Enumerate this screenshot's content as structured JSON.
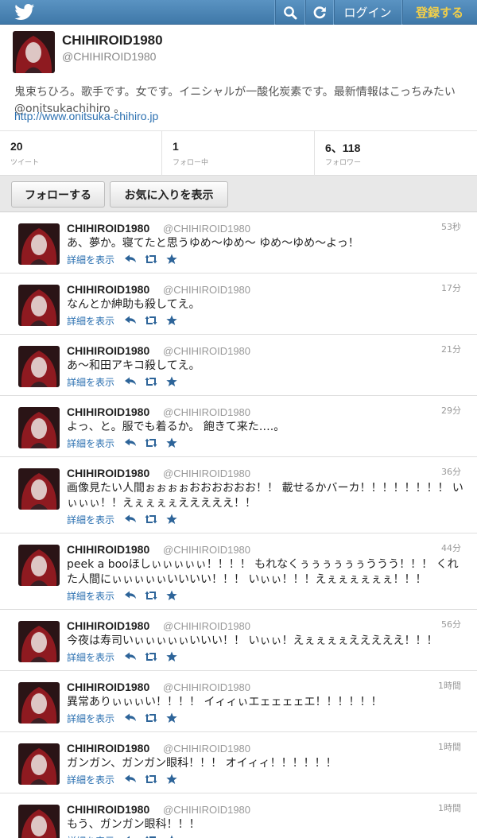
{
  "topbar": {
    "logo": "twitter-bird-icon",
    "search_icon": "search-icon",
    "refresh_icon": "refresh-icon",
    "login_label": "ログイン",
    "signup_label": "登録する"
  },
  "profile": {
    "name": "CHIHIROID1980",
    "handle": "@CHIHIROID1980",
    "bio": "鬼束ちひろ。歌手です。女です。イニシャルが一酸化炭素です。最新情報はこっちみたい @onitsukachihiro 。",
    "url": "http://www.onitsuka-chihiro.jp",
    "stats": [
      {
        "value": "20",
        "label": "ツイート"
      },
      {
        "value": "1",
        "label": "フォロー中"
      },
      {
        "value": "6、118",
        "label": "フォロワー"
      }
    ]
  },
  "actions": {
    "follow_label": "フォローする",
    "favorites_label": "お気に入りを表示"
  },
  "tweet_common": {
    "name": "CHIHIROID1980",
    "handle": "@CHIHIROID1980",
    "detail_label": "詳細を表示"
  },
  "tweets": [
    {
      "time": "53秒",
      "text": "あ、夢か。寝てたと思うゆめ〜ゆめ〜 ゆめ〜ゆめ〜よっ！"
    },
    {
      "time": "17分",
      "text": "なんとか紳助も殺してえ。"
    },
    {
      "time": "21分",
      "text": "あ〜和田アキコ殺してえ。"
    },
    {
      "time": "29分",
      "text": "よっ、と。服でも着るか。 飽きて来た….。"
    },
    {
      "time": "36分",
      "text": "画像見たい人間ぉぉぉぉおおおおおお！！ 載せるかバーカ！！！！！！！！ いぃぃぃ！！えぇぇぇぇえええええ！！"
    },
    {
      "time": "44分",
      "text": "peek a booほしぃぃぃぃぃ！！！！ もれなくぅぅぅぅぅぅううう！！！ くれた人間にぃぃぃぃぃいいいい！！！ いぃぃ！！！えぇぇぇぇぇぇ！！！"
    },
    {
      "time": "56分",
      "text": "今夜は寿司いぃぃぃぃぃいいい！！ いぃぃ！えぇぇぇぇえええええ！！！"
    },
    {
      "time": "1時間",
      "text": "異常ありぃぃぃい！！！！ イィィぃエェェェェエ！！！！！！"
    },
    {
      "time": "1時間",
      "text": "ガンガン、ガンガン眼科！！！ オイィィ！！！！！！"
    },
    {
      "time": "1時間",
      "text": "もう、ガンガン眼科！！！"
    }
  ]
}
